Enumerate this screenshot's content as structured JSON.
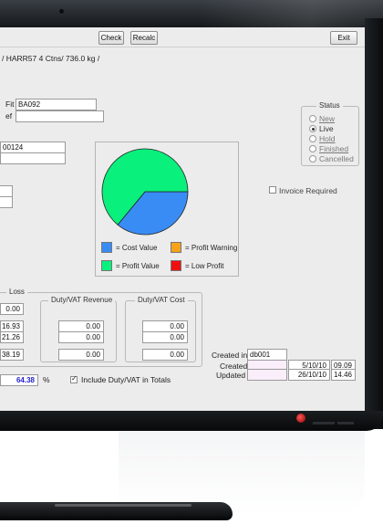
{
  "toolbar": {
    "check_label": "Check",
    "recalc_label": "Recalc",
    "exit_label": "Exit"
  },
  "info_line": "/ HARR57 4 Ctns/ 736.0 kg /",
  "fields": {
    "fit_label": "Fit",
    "fit_value": "BA092",
    "ref_label": "ef",
    "ref_value": "",
    "code_value": "00124",
    "code_value2": ""
  },
  "status": {
    "title": "Status",
    "options": [
      {
        "label": "New",
        "checked": false,
        "disabled": true
      },
      {
        "label": "Live",
        "checked": true,
        "disabled": false
      },
      {
        "label": "Hold",
        "checked": false,
        "disabled": true
      },
      {
        "label": "Finished",
        "checked": false,
        "disabled": true
      },
      {
        "label": "Cancelled",
        "checked": false,
        "disabled": true
      }
    ]
  },
  "invoice_required": {
    "label": "Invoice Required",
    "checked": false
  },
  "chart_data": {
    "type": "pie",
    "slices": [
      {
        "label": "Cost Value",
        "value": 0.36,
        "color": "#3a8cf5"
      },
      {
        "label": "Profit Value",
        "value": 0.64,
        "color": "#0af07c"
      }
    ],
    "legend": [
      {
        "label": "= Cost Value",
        "color": "#3a8cf5"
      },
      {
        "label": "= Profit Warning",
        "color": "#f7a21b"
      },
      {
        "label": "= Profit Value",
        "color": "#0af07c"
      },
      {
        "label": "= Low Profit",
        "color": "#f01010"
      }
    ]
  },
  "loss": {
    "title": "Loss",
    "value_top": "0.00",
    "row1": "16.93",
    "row2": "21.26",
    "row3": "38.19",
    "percent": "64.38",
    "percent_sign": "%"
  },
  "duty_vat_revenue": {
    "title": "Duty/VAT Revenue",
    "row1": "0.00",
    "row2": "0.00",
    "total": "0.00"
  },
  "duty_vat_cost": {
    "title": "Duty/VAT Cost",
    "row1": "0.00",
    "row2": "0.00",
    "total": "0.00"
  },
  "include_duty": {
    "label": "Include Duty/VAT in Totals",
    "checked": true
  },
  "audit": {
    "created_in_label": "Created in",
    "created_in_value": "db001",
    "created_label": "Created",
    "created_date": "5/10/10",
    "created_time": "09.09",
    "updated_label": "Updated",
    "updated_date": "26/10/10",
    "updated_time": "14.46"
  }
}
